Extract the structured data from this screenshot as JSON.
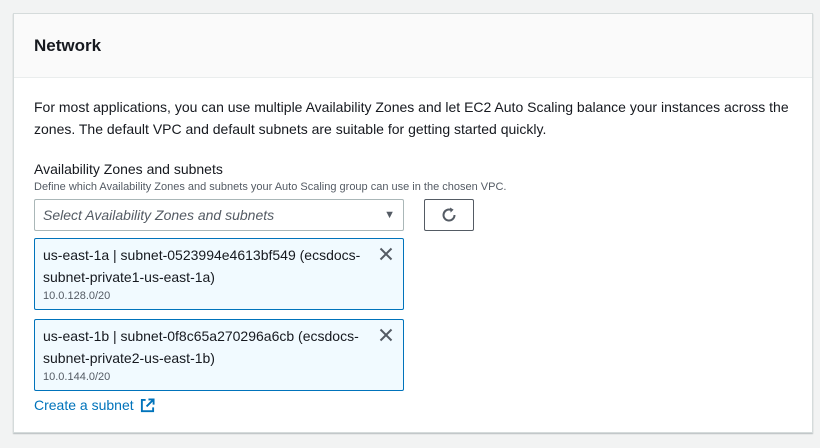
{
  "section": {
    "title": "Network",
    "description": "For most applications, you can use multiple Availability Zones and let EC2 Auto Scaling balance your instances across the zones. The default VPC and default subnets are suitable for getting started quickly."
  },
  "field": {
    "label": "Availability Zones and subnets",
    "hint": "Define which Availability Zones and subnets your Auto Scaling group can use in the chosen VPC.",
    "placeholder": "Select Availability Zones and subnets"
  },
  "tokens": [
    {
      "label": "us-east-1a | subnet-0523994e4613bf549 (ecsdocs-subnet-private1-us-east-1a)",
      "description": "10.0.128.0/20"
    },
    {
      "label": "us-east-1b | subnet-0f8c65a270296a6cb (ecsdocs-subnet-private2-us-east-1b)",
      "description": "10.0.144.0/20"
    }
  ],
  "link": {
    "label": "Create a subnet"
  },
  "icons": {
    "dropdown": "caret-down-icon",
    "refresh": "refresh-icon",
    "dismiss": "close-icon",
    "external": "external-link-icon"
  },
  "colors": {
    "link": "#0073bb",
    "token_border": "#0073bb",
    "token_background": "#f1faff"
  }
}
